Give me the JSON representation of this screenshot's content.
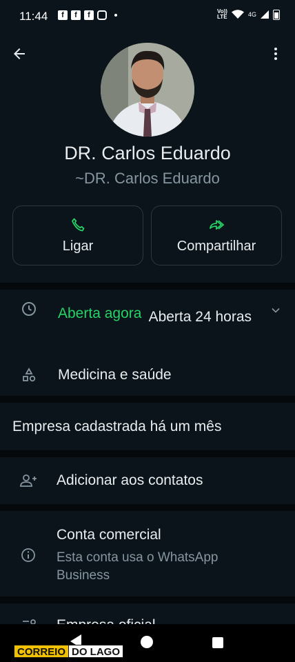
{
  "status_bar": {
    "time": "11:44",
    "network": "4G",
    "volte": [
      "Vo))",
      "LTE"
    ]
  },
  "profile": {
    "name": "DR. Carlos Eduardo",
    "push_name": "~DR. Carlos Eduardo"
  },
  "actions": [
    {
      "label": "Ligar",
      "icon": "phone-icon"
    },
    {
      "label": "Compartilhar",
      "icon": "share-icon"
    }
  ],
  "business_hours": {
    "status": "Aberta agora",
    "hours": "Aberta 24 horas"
  },
  "category": "Medicina e saúde",
  "registered": "Empresa cadastrada há um mês",
  "add_contact": "Adicionar aos contatos",
  "business_account": {
    "title": "Conta comercial",
    "subtitle": "Esta conta usa o WhatsApp Business"
  },
  "partial_next_row": "Empresa oficial",
  "watermark": {
    "part1": "CORREIO",
    "part2": "DO LAGO"
  },
  "colors": {
    "background": "#0b141a",
    "accent": "#25d366",
    "secondary_text": "#8696a0",
    "divider": "#06090b"
  }
}
